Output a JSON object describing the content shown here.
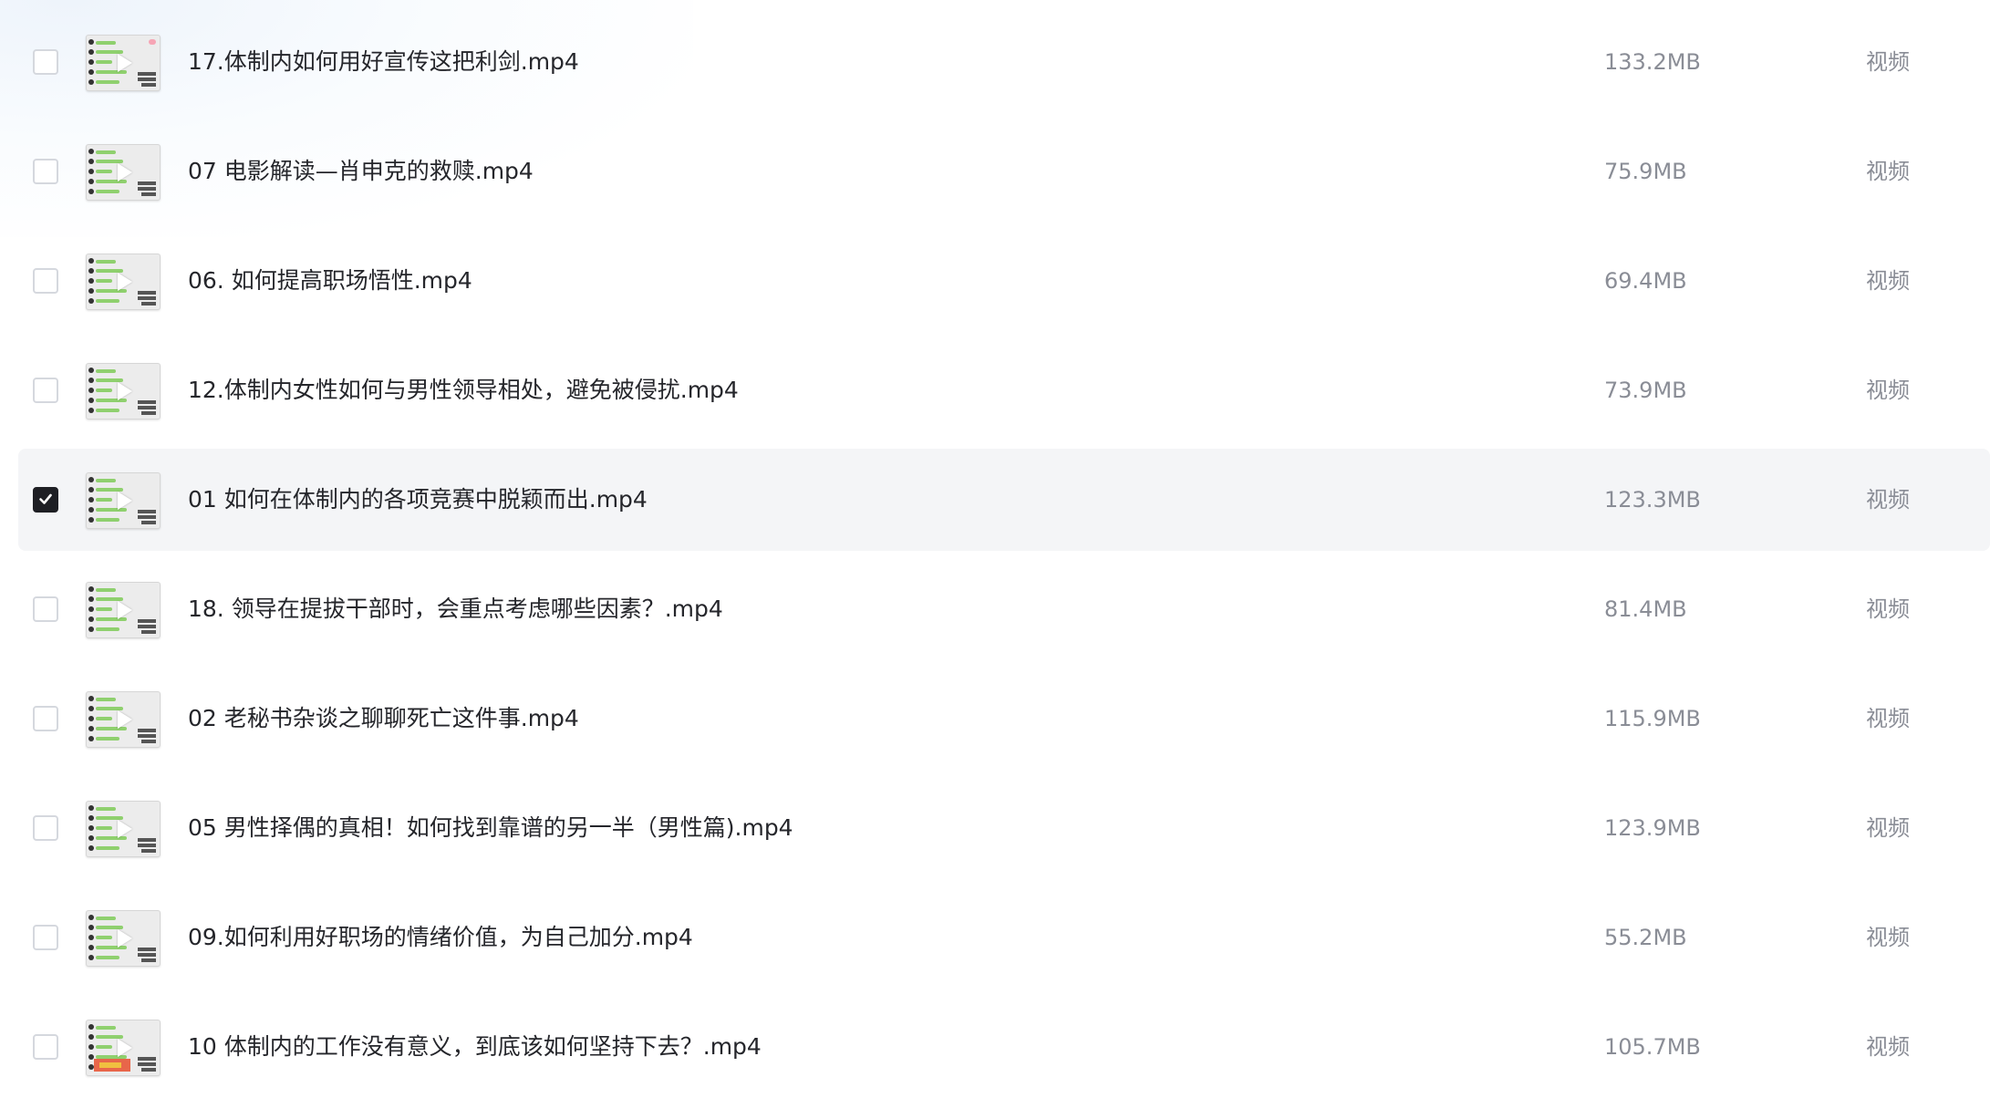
{
  "files": [
    {
      "name": "17.体制内如何用好宣传这把利剑.mp4",
      "size": "133.2MB",
      "type": "视频",
      "checked": false,
      "thumb_icon": "video-thumbnail-icon",
      "thumb_variant": "pink"
    },
    {
      "name": "07 电影解读—肖申克的救赎.mp4",
      "size": "75.9MB",
      "type": "视频",
      "checked": false,
      "thumb_icon": "video-thumbnail-icon",
      "thumb_variant": "plain"
    },
    {
      "name": "06. 如何提高职场悟性.mp4",
      "size": "69.4MB",
      "type": "视频",
      "checked": false,
      "thumb_icon": "video-thumbnail-icon",
      "thumb_variant": "plain"
    },
    {
      "name": "12.体制内女性如何与男性领导相处，避免被侵扰.mp4",
      "size": "73.9MB",
      "type": "视频",
      "checked": false,
      "thumb_icon": "video-thumbnail-icon",
      "thumb_variant": "plain"
    },
    {
      "name": "01 如何在体制内的各项竞赛中脱颖而出.mp4",
      "size": "123.3MB",
      "type": "视频",
      "checked": true,
      "thumb_icon": "video-thumbnail-icon",
      "thumb_variant": "plain"
    },
    {
      "name": "18. 领导在提拔干部时，会重点考虑哪些因素？.mp4",
      "size": "81.4MB",
      "type": "视频",
      "checked": false,
      "thumb_icon": "video-thumbnail-icon",
      "thumb_variant": "plain"
    },
    {
      "name": "02 老秘书杂谈之聊聊死亡这件事.mp4",
      "size": "115.9MB",
      "type": "视频",
      "checked": false,
      "thumb_icon": "video-thumbnail-icon",
      "thumb_variant": "plain"
    },
    {
      "name": "05 男性择偶的真相！如何找到靠谱的另一半（男性篇).mp4",
      "size": "123.9MB",
      "type": "视频",
      "checked": false,
      "thumb_icon": "video-thumbnail-icon",
      "thumb_variant": "plain"
    },
    {
      "name": "09.如何利用好职场的情绪价值，为自己加分.mp4",
      "size": "55.2MB",
      "type": "视频",
      "checked": false,
      "thumb_icon": "video-thumbnail-icon",
      "thumb_variant": "plain"
    },
    {
      "name": "10 体制内的工作没有意义，到底该如何坚持下去？.mp4",
      "size": "105.7MB",
      "type": "视频",
      "checked": false,
      "thumb_icon": "video-thumbnail-icon",
      "thumb_variant": "banner"
    }
  ],
  "colors": {
    "selected_row_bg": "#f4f5f7",
    "checkbox_checked": "#1e1f24",
    "name_text": "#25262b",
    "meta_text": "#8a8d96",
    "thumb_bar": "#8fd06e"
  }
}
